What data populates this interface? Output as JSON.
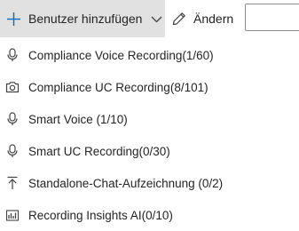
{
  "toolbar": {
    "add_users_label": "Benutzer hinzufügen",
    "edit_label": "Ändern",
    "search_value": ""
  },
  "menu": {
    "items": [
      {
        "label": "Compliance Voice Recording(1/60)",
        "icon": "microphone-icon"
      },
      {
        "label": "Compliance UC Recording(8/101)",
        "icon": "camera-icon"
      },
      {
        "label": "Smart Voice (1/10)",
        "icon": "microphone-icon"
      },
      {
        "label": "Smart UC Recording(0/30)",
        "icon": "microphone-icon"
      },
      {
        "label": "Standalone-Chat-Aufzeichnung (0/2)",
        "icon": "upload-arrow-icon"
      },
      {
        "label": "Recording Insights AI(0/10)",
        "icon": "bar-chart-icon"
      }
    ]
  },
  "colors": {
    "button_bg": "#e1e1e1",
    "accent": "#0f6cbd",
    "text": "#242424",
    "icon": "#424242"
  }
}
